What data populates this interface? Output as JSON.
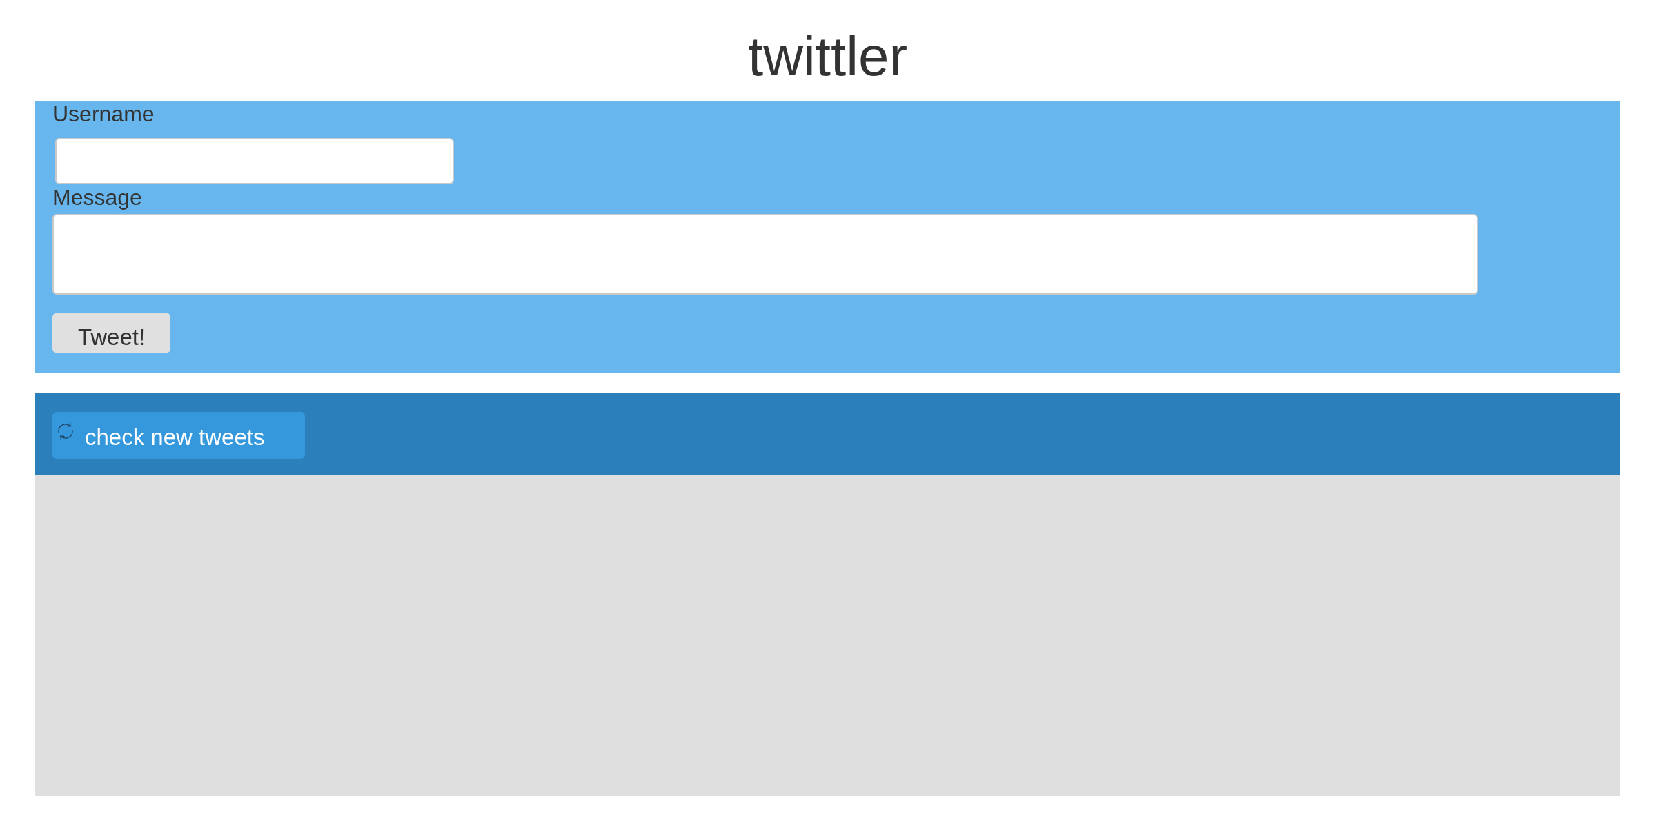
{
  "title": "twittler",
  "form": {
    "fields": [
      {
        "kind": "input",
        "label": "Username"
      },
      {
        "kind": "textarea",
        "label": "Message"
      }
    ],
    "submit": "Tweet!"
  },
  "toolbar": {
    "refresh_button": "check new tweets"
  }
}
